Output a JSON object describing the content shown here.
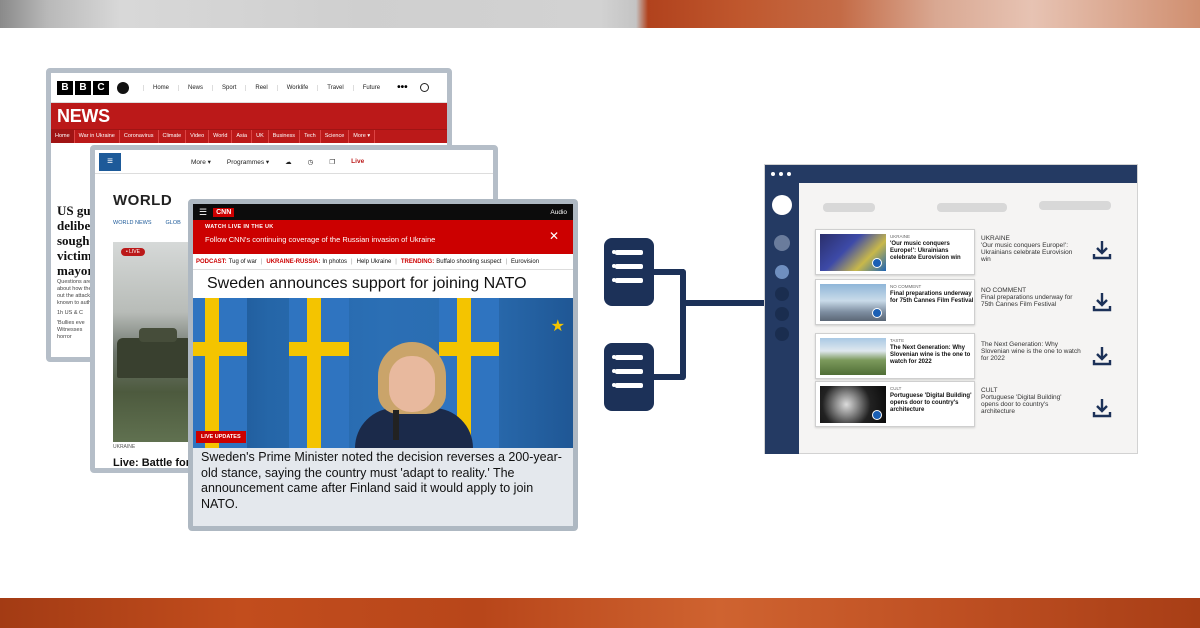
{
  "bbc": {
    "logo": [
      "B",
      "B",
      "C"
    ],
    "nav": [
      "Home",
      "News",
      "Sport",
      "Reel",
      "Worklife",
      "Travel",
      "Future"
    ],
    "more": "•••",
    "brand": "NEWS",
    "subnav": [
      "Home",
      "War in Ukraine",
      "Coronavirus",
      "Climate",
      "Video",
      "World",
      "Asia",
      "UK",
      "Business",
      "Tech",
      "Science",
      "More ▾"
    ],
    "headline": "US gu deliber sought victim mayor",
    "blurb": "Questions are about how the out the attack known to auth",
    "meta": "1h  US & C",
    "quote": "'Bullies eve Witnesses horror"
  },
  "world": {
    "nav": [
      "More ▾",
      "Programmes ▾"
    ],
    "live": "Live",
    "title": "WORLD",
    "tabs": [
      "WORLD NEWS",
      "GLOB"
    ],
    "live_badge": "• LIVE",
    "section": "UKRAINE",
    "caption": "Live: Battle for e"
  },
  "cnn": {
    "logo": "CNN",
    "audio": "Audio",
    "banner_kicker": "WATCH LIVE IN THE UK",
    "banner_text": "Follow CNN's continuing coverage of the Russian invasion of Ukraine",
    "ticker": {
      "podcast_label": "PODCAST:",
      "podcast_text": "Tug of war",
      "ukr_label": "UKRAINE-RUSSIA:",
      "ukr_text": "In photos",
      "help": "Help Ukraine",
      "trending_label": "TRENDING:",
      "trending_text": "Buffalo shooting suspect",
      "euro": "Eurovision"
    },
    "headline": "Sweden announces support for joining NATO",
    "live_updates": "LIVE UPDATES",
    "body": "Sweden's Prime Minister noted the decision reverses a 200-year-old stance, saying the country must 'adapt to reality.' The announcement came after Finland said it would apply to join NATO."
  },
  "feed": [
    {
      "category": "UKRAINE",
      "title": "'Our music conquers Europe!': Ukrainians celebrate Eurovision win",
      "meta_category": "UKRAINE",
      "meta_title": "'Our music conquers Europe!': Ukrainians celebrate Eurovision win"
    },
    {
      "category": "NO COMMENT",
      "title": "Final preparations underway for 75th Cannes Film Festival",
      "meta_category": "NO COMMENT",
      "meta_title": "Final preparations underway for 75th Cannes Film Festival"
    },
    {
      "category": "TASTE",
      "title": "The Next Generation: Why Slovenian wine is the one to watch for 2022",
      "meta_category": "",
      "meta_title": "The Next Generation: Why Slovenian wine is the one to watch for 2022"
    },
    {
      "category": "CULT",
      "title": "Portuguese 'Digital Building' opens door to country's architecture",
      "meta_category": "CULT",
      "meta_title": "Portuguese 'Digital Building' opens door to country's architecture"
    }
  ],
  "colors": {
    "bbc_red": "#bb1919",
    "cnn_red": "#cc0000",
    "navy": "#1c3158",
    "app_navy": "#243a63"
  }
}
